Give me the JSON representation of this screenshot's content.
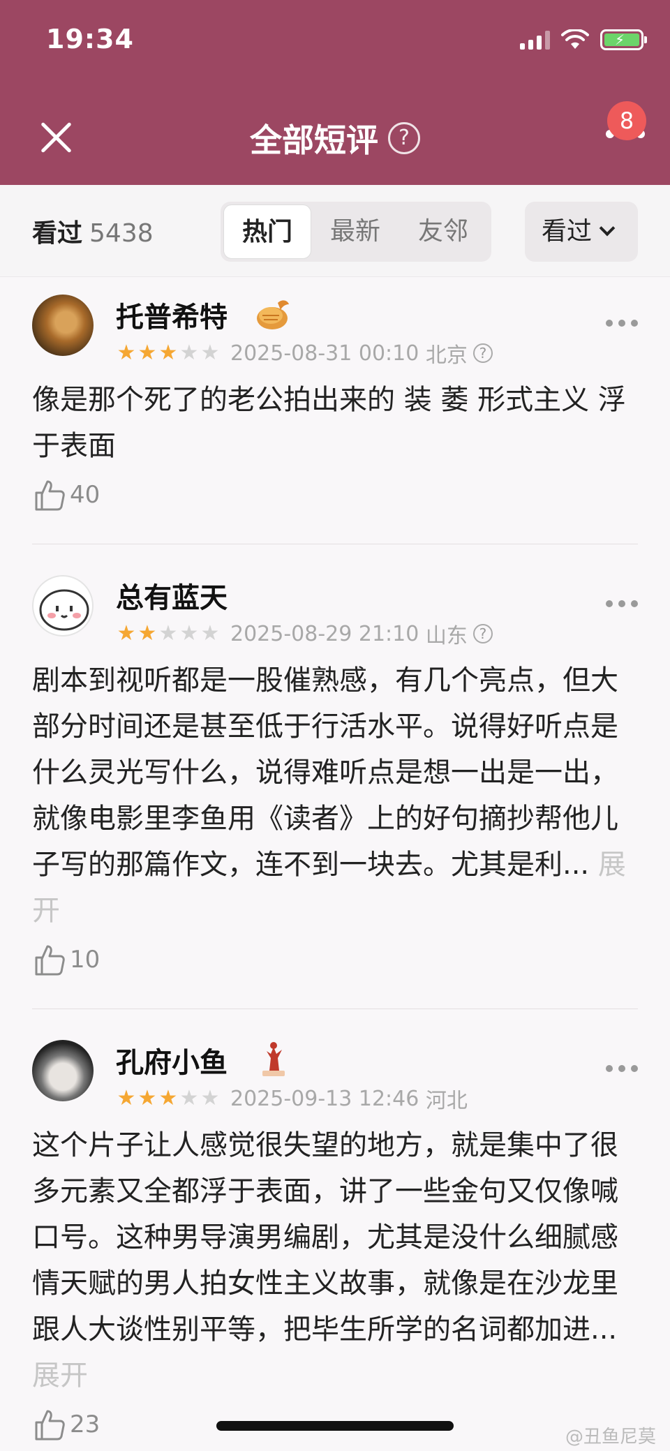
{
  "status_bar": {
    "time": "19:34"
  },
  "header": {
    "title": "全部短评",
    "help_glyph": "?",
    "badge_count": "8"
  },
  "filter": {
    "seen_label": "看过",
    "seen_count": "5438",
    "tabs": [
      {
        "label": "热门",
        "active": true
      },
      {
        "label": "最新",
        "active": false
      },
      {
        "label": "友邻",
        "active": false
      }
    ],
    "dropdown_label": "看过"
  },
  "comments": [
    {
      "username": "托普希特",
      "rating": 3,
      "date": "2025-08-31 00:10",
      "location": "北京",
      "has_location_help": true,
      "text": "像是那个死了的老公拍出来的 装 萎 形式主义 浮于表面",
      "expand": "",
      "likes": "40"
    },
    {
      "username": "总有蓝天",
      "rating": 2,
      "date": "2025-08-29 21:10",
      "location": "山东",
      "has_location_help": true,
      "text": "剧本到视听都是一股催熟感，有几个亮点，但大部分时间还是甚至低于行活水平。说得好听点是什么灵光写什么，说得难听点是想一出是一出，就像电影里李鱼用《读者》上的好句摘抄帮他儿子写的那篇作文，连不到一块去。尤其是利...",
      "expand": "展开",
      "likes": "10"
    },
    {
      "username": "孔府小鱼",
      "rating": 3,
      "date": "2025-09-13 12:46",
      "location": "河北",
      "has_location_help": false,
      "text": "这个片子让人感觉很失望的地方，就是集中了很多元素又全都浮于表面，讲了一些金句又仅像喊口号。这种男导演男编剧，尤其是没什么细腻感情天赋的男人拍女性主义故事，就像是在沙龙里跟人大谈性别平等，把毕生所学的名词都加进...",
      "expand": "展开",
      "likes": "23"
    }
  ],
  "watermark": "@丑鱼尼莫",
  "colors": {
    "header_bg": "#9c4762",
    "star_on": "#f5a733",
    "star_off": "#d3d3d3",
    "badge": "#ee5a5a"
  }
}
